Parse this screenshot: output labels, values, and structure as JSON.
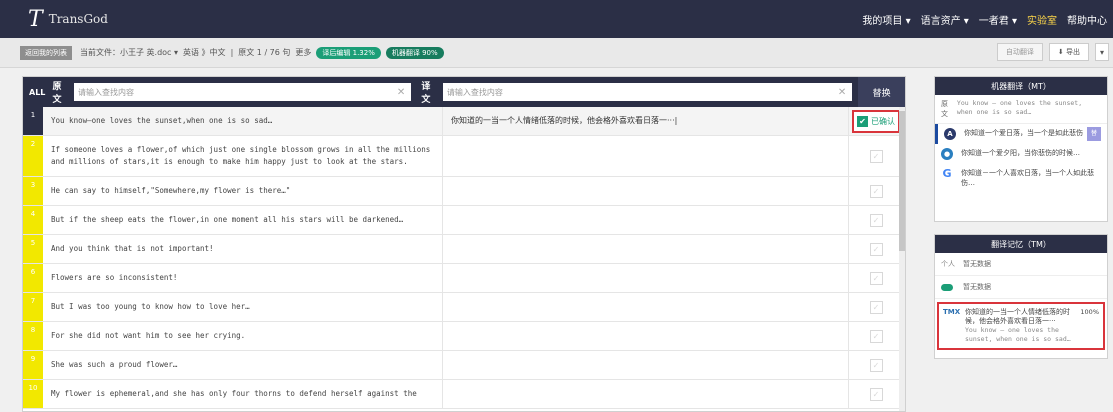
{
  "app": {
    "logo": "T",
    "name": "TransGod"
  },
  "topnav": {
    "my_projects": "我的项目 ▾",
    "language_assets": "语言资产 ▾",
    "user": "一者君 ▾",
    "lab": "实验室",
    "help": "帮助中心"
  },
  "subbar": {
    "back": "返回我的列表",
    "current_file": "当前文件：小王子 英.doc ▾",
    "lang": "英语  》中文",
    "sep": "|",
    "source_count": "原文 1 / 76  句",
    "search_hint": "更多",
    "progress_edit": "译后编辑 1.32%",
    "progress_mt": "机器翻译 90%",
    "auto_translate": "自动翻译",
    "export": "⬇ 导出",
    "more": "▾"
  },
  "search": {
    "all_label": "ALL",
    "source_label": "原文",
    "source_placeholder": "请输入查找内容",
    "target_label": "译文",
    "target_placeholder": "请输入查找内容",
    "replace": "替换"
  },
  "rows": [
    {
      "n": "1",
      "src": "You know—one loves the sunset,when one is so sad…",
      "tgt": "你知道的一当一个人情绪低落的时候，他会格外喜欢看日落一···|",
      "confirmed": "已确认"
    },
    {
      "n": "2",
      "src": "If someone loves a flower,of which just one single blossom grows in all the millions and millions of stars,it is enough to make him happy just to look at the stars.",
      "tgt": ""
    },
    {
      "n": "3",
      "src": "He can say to himself,\"Somewhere,my flower is there…\"",
      "tgt": ""
    },
    {
      "n": "4",
      "src": "But if the sheep eats the flower,in one moment all his stars will be darkened…",
      "tgt": ""
    },
    {
      "n": "5",
      "src": "And you think that is not important!",
      "tgt": ""
    },
    {
      "n": "6",
      "src": "Flowers are so inconsistent!",
      "tgt": ""
    },
    {
      "n": "7",
      "src": "But I was too young to know how to love her…",
      "tgt": ""
    },
    {
      "n": "8",
      "src": "For she did not want him to see her crying.",
      "tgt": ""
    },
    {
      "n": "9",
      "src": "She was such a proud flower…",
      "tgt": ""
    },
    {
      "n": "10",
      "src": "My flower is ephemeral,and she has only four thorns to defend herself against the",
      "tgt": ""
    }
  ],
  "mt": {
    "title": "机器翻译（MT）",
    "source_label": "原文",
    "source_text": "You know — one loves the sunset, when one is so sad…",
    "items": [
      {
        "text": "你知道一个爱日落，当一个是如此悲伤",
        "badge": "替"
      },
      {
        "text": "你知道一个爱夕阳，当你悲伤的时候…"
      },
      {
        "text": "你知道－一个人喜欢日落，当一个人如此悲伤…"
      }
    ]
  },
  "tm": {
    "title": "翻译记忆（TM）",
    "personal_label": "个人",
    "personal_value": "暂无数据",
    "cloud_value": "暂无数据",
    "match_logo": "TMX",
    "match_zh": "你知道的一当一个人情绪低落的时候，他会格外喜欢看日落一···",
    "match_en": "You know — one loves the sunset, when one is so sad…",
    "match_pct": "100%"
  },
  "colors": {
    "header": "#2b2f46",
    "accent": "#1b9e77",
    "highlight_border": "#d9343b",
    "row_number": "#f2e800"
  }
}
